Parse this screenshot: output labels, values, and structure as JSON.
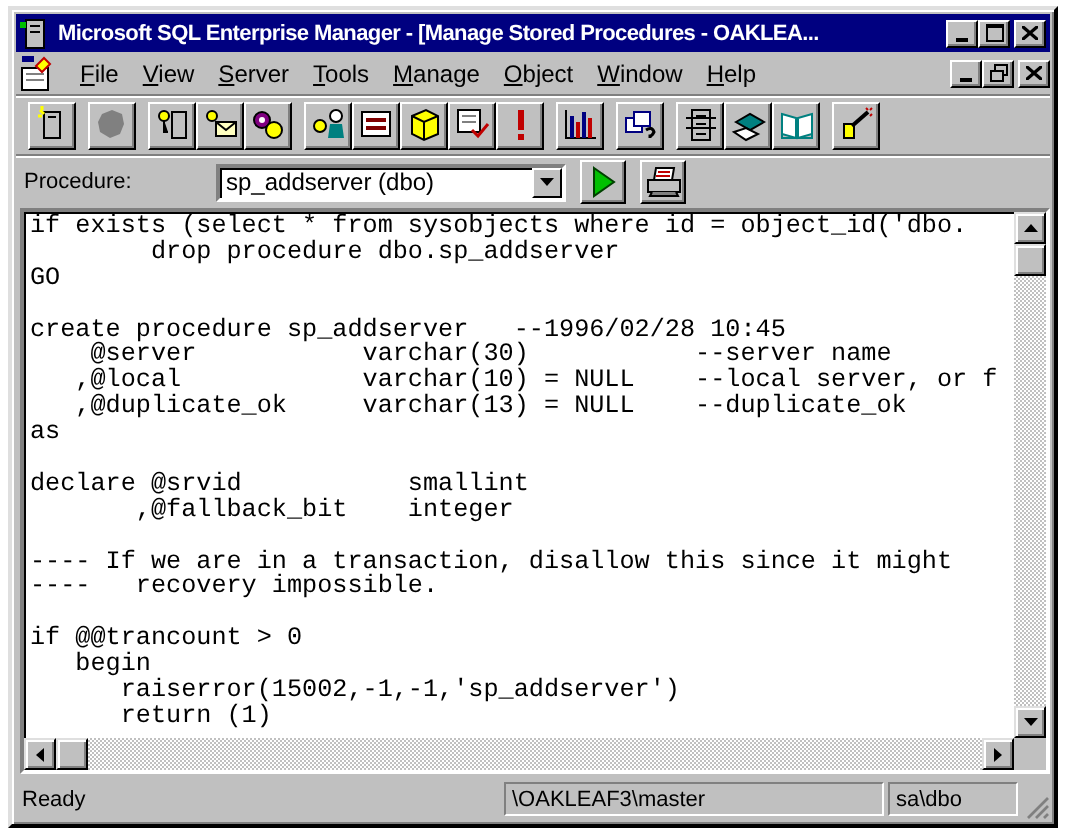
{
  "window": {
    "title": "Microsoft SQL Enterprise Manager - [Manage Stored Procedures - OAKLEA..."
  },
  "menu": [
    "File",
    "View",
    "Server",
    "Tools",
    "Manage",
    "Object",
    "Window",
    "Help"
  ],
  "procedure": {
    "label": "Procedure:",
    "value": "sp_addserver (dbo)"
  },
  "code": {
    "blocks": [
      [
        "if exists (select * from sysobjects where id = object_id('dbo.",
        "        drop procedure dbo.sp_addserver",
        "GO"
      ],
      [
        "create procedure sp_addserver   --1996/02/28 10:45",
        "    @server           varchar(30)           --server name",
        "   ,@local            varchar(10) = NULL    --local server, or f",
        "   ,@duplicate_ok     varchar(13) = NULL    --duplicate_ok",
        "as"
      ],
      [
        "declare @srvid           smallint",
        "       ,@fallback_bit    integer"
      ],
      [
        "---- If we are in a transaction, disallow this since it might",
        "----   recovery impossible."
      ],
      [
        "if @@trancount > 0",
        "   begin",
        "      raiserror(15002,-1,-1,'sp_addserver')",
        "      return (1)"
      ]
    ]
  },
  "status_bar": {
    "message": "Ready",
    "server": "\\OAKLEAF3\\master",
    "user": "sa\\dbo"
  }
}
